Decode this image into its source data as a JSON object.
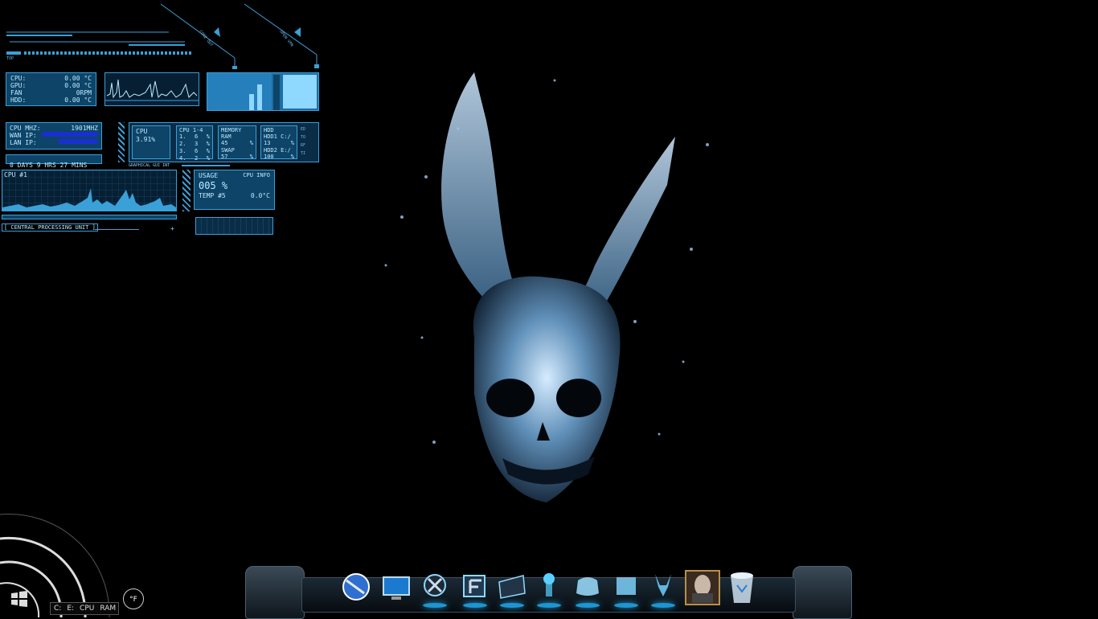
{
  "hud": {
    "top_left_label": "TOP",
    "core_out": "CORE OUT",
    "open_vpn": "OPEN VPN",
    "temps": [
      {
        "label": "CPU:",
        "value": "0.00 °C"
      },
      {
        "label": "GPU:",
        "value": "0.00 °C"
      },
      {
        "label": "FAN",
        "value": "0RPM"
      },
      {
        "label": "HDD:",
        "value": "0.00 °C"
      }
    ],
    "net": {
      "cpu_mhz_label": "CPU MHZ:",
      "cpu_mhz_value": "1901MHZ",
      "wan_label": "WAN IP:",
      "lan_label": "LAN IP:"
    },
    "uptime": "0 DAYS  9 HRS 27 MINS",
    "cpu_box": {
      "label": "CPU",
      "value": "3.91%"
    },
    "cores": {
      "header": "CPU 1-4",
      "rows": [
        {
          "n": "1.",
          "v": "6",
          "u": "%"
        },
        {
          "n": "2.",
          "v": "3",
          "u": "%"
        },
        {
          "n": "3.",
          "v": "6",
          "u": "%"
        },
        {
          "n": "4.",
          "v": "2",
          "u": "%"
        }
      ]
    },
    "memory": {
      "header": "MEMORY",
      "ram_label": "RAM",
      "ram_value": "45",
      "ram_unit": "%",
      "swap_label": "SWAP",
      "swap_value": "57",
      "swap_unit": "%"
    },
    "hdd": {
      "header": "HDD",
      "hdd1_label": "HDD1 C:/",
      "hdd1_value": "13",
      "hdd2_label": "HDD2 E:/",
      "hdd2_value": "100",
      "unit": "%"
    },
    "side_tabs": [
      "ED",
      "TO",
      "RF",
      "TI"
    ],
    "graphical_label": "GRAPHICAL GUI INT",
    "cpu1_label": "CPU #1",
    "usage": {
      "header": "USAGE",
      "info_label": "CPU INFO",
      "value": "005 %",
      "temp_label": "TEMP #5",
      "temp_value": "0.0°C"
    },
    "central_label": "[ CENTRAL PROCESSING UNIT ]"
  },
  "taskbar": {
    "start_icon": "windows-logo-icon",
    "tray_items": [
      "C:",
      "E:",
      "CPU",
      "RAM"
    ],
    "temp_unit": "°F"
  },
  "dock": {
    "icons": [
      {
        "name": "browser-globe-icon"
      },
      {
        "name": "computer-icon"
      },
      {
        "name": "xbox-icon"
      },
      {
        "name": "folder-f-icon"
      },
      {
        "name": "documents-icon"
      },
      {
        "name": "hologram-icon"
      },
      {
        "name": "gamepad-icon"
      },
      {
        "name": "folder-hologram-icon"
      },
      {
        "name": "bunny-hologram-icon"
      },
      {
        "name": "game-portrait-icon"
      },
      {
        "name": "recycle-bin-icon"
      }
    ]
  },
  "colors": {
    "accent": "#3aa0d8",
    "panel": "#0d4468",
    "glow": "#23b7ff",
    "background": "#000000"
  }
}
